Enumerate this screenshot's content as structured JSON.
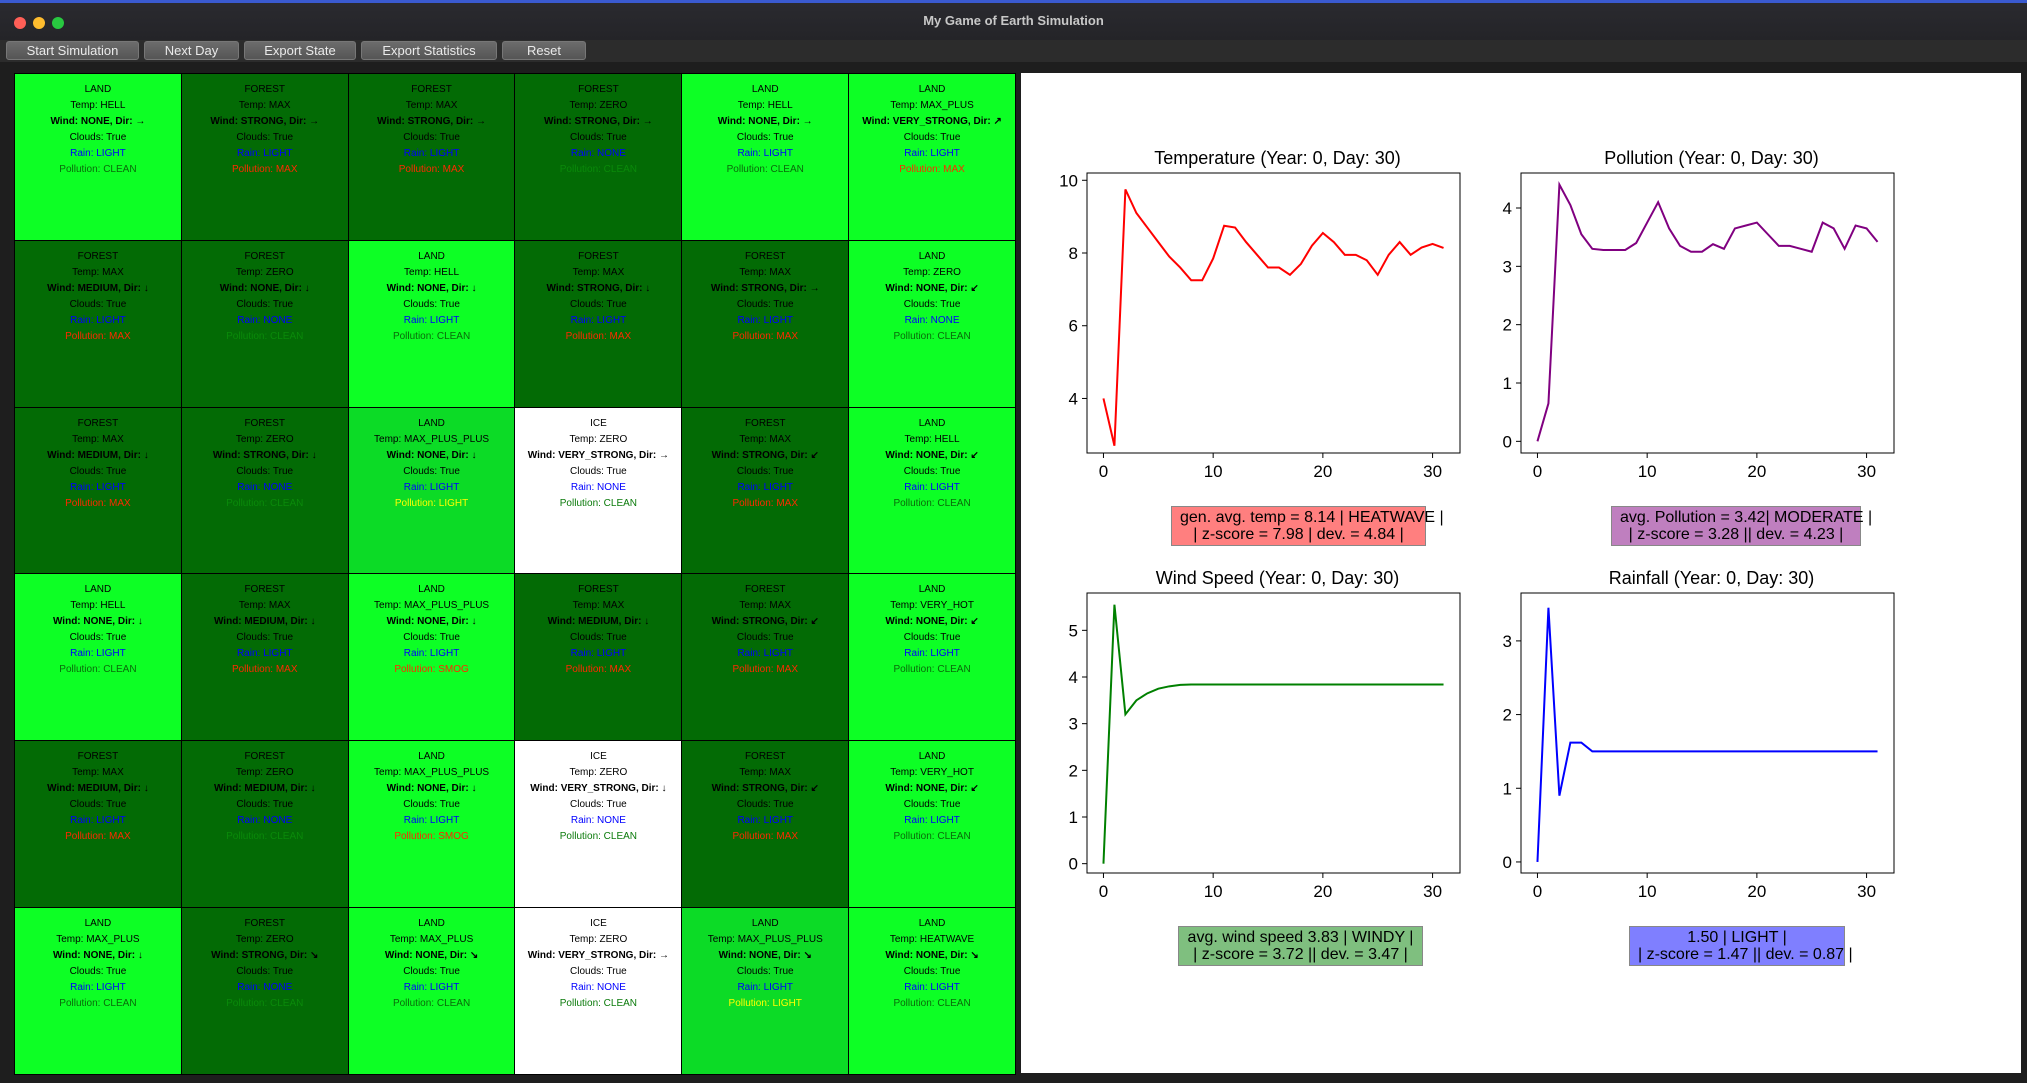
{
  "window": {
    "title": "My Game of Earth Simulation"
  },
  "toolbar": {
    "start": "Start Simulation",
    "next": "Next Day",
    "export_state": "Export State",
    "export_stats": "Export Statistics",
    "reset": "Reset"
  },
  "grid": {
    "colors": {
      "land": "#0dff25",
      "forest": "#036b05",
      "ice": "#ffffff",
      "light_land": "#0cdb26"
    },
    "cells": [
      {
        "type": "LAND",
        "bg": "land",
        "temp": "Temp: HELL",
        "wind": "Wind: NONE, Dir: →",
        "clouds": "Clouds: True",
        "rain": "Rain: LIGHT",
        "pollution": "Pollution: CLEAN",
        "pc": "#0a6a0a"
      },
      {
        "type": "FOREST",
        "bg": "forest",
        "temp": "Temp: MAX",
        "wind": "Wind: STRONG, Dir: →",
        "clouds": "Clouds: True",
        "rain": "Rain: LIGHT",
        "pollution": "Pollution: MAX",
        "pc": "#ff2a00"
      },
      {
        "type": "FOREST",
        "bg": "forest",
        "temp": "Temp: MAX",
        "wind": "Wind: STRONG, Dir: →",
        "clouds": "Clouds: True",
        "rain": "Rain: LIGHT",
        "pollution": "Pollution: MAX",
        "pc": "#ff2a00"
      },
      {
        "type": "FOREST",
        "bg": "forest",
        "temp": "Temp: ZERO",
        "wind": "Wind: STRONG, Dir: →",
        "clouds": "Clouds: True",
        "rain": "Rain: NONE",
        "pollution": "Pollution: CLEAN",
        "pc": "#0a8a0a"
      },
      {
        "type": "LAND",
        "bg": "land",
        "temp": "Temp: HELL",
        "wind": "Wind: NONE, Dir: →",
        "clouds": "Clouds: True",
        "rain": "Rain: LIGHT",
        "pollution": "Pollution: CLEAN",
        "pc": "#0a6a0a"
      },
      {
        "type": "LAND",
        "bg": "land",
        "temp": "Temp: MAX_PLUS",
        "wind": "Wind: VERY_STRONG, Dir: ↗",
        "clouds": "Clouds: True",
        "rain": "Rain: LIGHT",
        "pollution": "Pollution: MAX",
        "pc": "#ff2a00"
      },
      {
        "type": "FOREST",
        "bg": "forest",
        "temp": "Temp: MAX",
        "wind": "Wind: MEDIUM, Dir: ↓",
        "clouds": "Clouds: True",
        "rain": "Rain: LIGHT",
        "pollution": "Pollution: MAX",
        "pc": "#ff2a00"
      },
      {
        "type": "FOREST",
        "bg": "forest",
        "temp": "Temp: ZERO",
        "wind": "Wind: NONE, Dir: ↓",
        "clouds": "Clouds: True",
        "rain": "Rain: NONE",
        "pollution": "Pollution: CLEAN",
        "pc": "#0a8a0a"
      },
      {
        "type": "LAND",
        "bg": "land",
        "temp": "Temp: HELL",
        "wind": "Wind: NONE, Dir: ↓",
        "clouds": "Clouds: True",
        "rain": "Rain: LIGHT",
        "pollution": "Pollution: CLEAN",
        "pc": "#0a6a0a"
      },
      {
        "type": "FOREST",
        "bg": "forest",
        "temp": "Temp: MAX",
        "wind": "Wind: STRONG, Dir: ↓",
        "clouds": "Clouds: True",
        "rain": "Rain: LIGHT",
        "pollution": "Pollution: MAX",
        "pc": "#ff2a00"
      },
      {
        "type": "FOREST",
        "bg": "forest",
        "temp": "Temp: MAX",
        "wind": "Wind: STRONG, Dir: →",
        "clouds": "Clouds: True",
        "rain": "Rain: LIGHT",
        "pollution": "Pollution: MAX",
        "pc": "#ff2a00"
      },
      {
        "type": "LAND",
        "bg": "land",
        "temp": "Temp: ZERO",
        "wind": "Wind: NONE, Dir: ↙",
        "clouds": "Clouds: True",
        "rain": "Rain: NONE",
        "pollution": "Pollution: CLEAN",
        "pc": "#0a6a0a"
      },
      {
        "type": "FOREST",
        "bg": "forest",
        "temp": "Temp: MAX",
        "wind": "Wind: MEDIUM, Dir: ↓",
        "clouds": "Clouds: True",
        "rain": "Rain: LIGHT",
        "pollution": "Pollution: MAX",
        "pc": "#ff2a00"
      },
      {
        "type": "FOREST",
        "bg": "forest",
        "temp": "Temp: ZERO",
        "wind": "Wind: STRONG, Dir: ↓",
        "clouds": "Clouds: True",
        "rain": "Rain: NONE",
        "pollution": "Pollution: CLEAN",
        "pc": "#0a8a0a"
      },
      {
        "type": "LAND",
        "bg": "light_land",
        "temp": "Temp: MAX_PLUS_PLUS",
        "wind": "Wind: NONE, Dir: ↓",
        "clouds": "Clouds: True",
        "rain": "Rain: LIGHT",
        "pollution": "Pollution: LIGHT",
        "pc": "#ffff00"
      },
      {
        "type": "ICE",
        "bg": "ice",
        "temp": "Temp: ZERO",
        "wind": "Wind: VERY_STRONG, Dir: →",
        "clouds": "Clouds: True",
        "rain": "Rain: NONE",
        "pollution": "Pollution: CLEAN",
        "pc": "#0a7a0a"
      },
      {
        "type": "FOREST",
        "bg": "forest",
        "temp": "Temp: MAX",
        "wind": "Wind: STRONG, Dir: ↙",
        "clouds": "Clouds: True",
        "rain": "Rain: LIGHT",
        "pollution": "Pollution: MAX",
        "pc": "#ff2a00"
      },
      {
        "type": "LAND",
        "bg": "land",
        "temp": "Temp: HELL",
        "wind": "Wind: NONE, Dir: ↙",
        "clouds": "Clouds: True",
        "rain": "Rain: LIGHT",
        "pollution": "Pollution: CLEAN",
        "pc": "#0a6a0a"
      },
      {
        "type": "LAND",
        "bg": "land",
        "temp": "Temp: HELL",
        "wind": "Wind: NONE, Dir: ↓",
        "clouds": "Clouds: True",
        "rain": "Rain: LIGHT",
        "pollution": "Pollution: CLEAN",
        "pc": "#0a6a0a"
      },
      {
        "type": "FOREST",
        "bg": "forest",
        "temp": "Temp: MAX",
        "wind": "Wind: MEDIUM, Dir: ↓",
        "clouds": "Clouds: True",
        "rain": "Rain: LIGHT",
        "pollution": "Pollution: MAX",
        "pc": "#ff2a00"
      },
      {
        "type": "LAND",
        "bg": "land",
        "temp": "Temp: MAX_PLUS_PLUS",
        "wind": "Wind: NONE, Dir: ↓",
        "clouds": "Clouds: True",
        "rain": "Rain: LIGHT",
        "pollution": "Pollution: SMOG",
        "pc": "#ff2a00"
      },
      {
        "type": "FOREST",
        "bg": "forest",
        "temp": "Temp: MAX",
        "wind": "Wind: MEDIUM, Dir: ↓",
        "clouds": "Clouds: True",
        "rain": "Rain: LIGHT",
        "pollution": "Pollution: MAX",
        "pc": "#ff2a00"
      },
      {
        "type": "FOREST",
        "bg": "forest",
        "temp": "Temp: MAX",
        "wind": "Wind: STRONG, Dir: ↙",
        "clouds": "Clouds: True",
        "rain": "Rain: LIGHT",
        "pollution": "Pollution: MAX",
        "pc": "#ff2a00"
      },
      {
        "type": "LAND",
        "bg": "land",
        "temp": "Temp: VERY_HOT",
        "wind": "Wind: NONE, Dir: ↙",
        "clouds": "Clouds: True",
        "rain": "Rain: LIGHT",
        "pollution": "Pollution: CLEAN",
        "pc": "#0a6a0a"
      },
      {
        "type": "FOREST",
        "bg": "forest",
        "temp": "Temp: MAX",
        "wind": "Wind: MEDIUM, Dir: ↓",
        "clouds": "Clouds: True",
        "rain": "Rain: LIGHT",
        "pollution": "Pollution: MAX",
        "pc": "#ff2a00"
      },
      {
        "type": "FOREST",
        "bg": "forest",
        "temp": "Temp: ZERO",
        "wind": "Wind: MEDIUM, Dir: ↓",
        "clouds": "Clouds: True",
        "rain": "Rain: NONE",
        "pollution": "Pollution: CLEAN",
        "pc": "#0a8a0a"
      },
      {
        "type": "LAND",
        "bg": "land",
        "temp": "Temp: MAX_PLUS_PLUS",
        "wind": "Wind: NONE, Dir: ↓",
        "clouds": "Clouds: True",
        "rain": "Rain: LIGHT",
        "pollution": "Pollution: SMOG",
        "pc": "#ff2a00"
      },
      {
        "type": "ICE",
        "bg": "ice",
        "temp": "Temp: ZERO",
        "wind": "Wind: VERY_STRONG, Dir: ↓",
        "clouds": "Clouds: True",
        "rain": "Rain: NONE",
        "pollution": "Pollution: CLEAN",
        "pc": "#0a7a0a"
      },
      {
        "type": "FOREST",
        "bg": "forest",
        "temp": "Temp: MAX",
        "wind": "Wind: STRONG, Dir: ↙",
        "clouds": "Clouds: True",
        "rain": "Rain: LIGHT",
        "pollution": "Pollution: MAX",
        "pc": "#ff2a00"
      },
      {
        "type": "LAND",
        "bg": "land",
        "temp": "Temp: VERY_HOT",
        "wind": "Wind: NONE, Dir: ↙",
        "clouds": "Clouds: True",
        "rain": "Rain: LIGHT",
        "pollution": "Pollution: CLEAN",
        "pc": "#0a6a0a"
      },
      {
        "type": "LAND",
        "bg": "land",
        "temp": "Temp: MAX_PLUS",
        "wind": "Wind: NONE, Dir: ↓",
        "clouds": "Clouds: True",
        "rain": "Rain: LIGHT",
        "pollution": "Pollution: CLEAN",
        "pc": "#0a6a0a"
      },
      {
        "type": "FOREST",
        "bg": "forest",
        "temp": "Temp: ZERO",
        "wind": "Wind: STRONG, Dir: ↘",
        "clouds": "Clouds: True",
        "rain": "Rain: NONE",
        "pollution": "Pollution: CLEAN",
        "pc": "#0a8a0a"
      },
      {
        "type": "LAND",
        "bg": "land",
        "temp": "Temp: MAX_PLUS",
        "wind": "Wind: NONE, Dir: ↘",
        "clouds": "Clouds: True",
        "rain": "Rain: LIGHT",
        "pollution": "Pollution: CLEAN",
        "pc": "#0a6a0a"
      },
      {
        "type": "ICE",
        "bg": "ice",
        "temp": "Temp: ZERO",
        "wind": "Wind: VERY_STRONG, Dir: →",
        "clouds": "Clouds: True",
        "rain": "Rain: NONE",
        "pollution": "Pollution: CLEAN",
        "pc": "#0a7a0a"
      },
      {
        "type": "LAND",
        "bg": "light_land",
        "temp": "Temp: MAX_PLUS_PLUS",
        "wind": "Wind: NONE, Dir: ↘",
        "clouds": "Clouds: True",
        "rain": "Rain: LIGHT",
        "pollution": "Pollution: LIGHT",
        "pc": "#ffff00"
      },
      {
        "type": "LAND",
        "bg": "land",
        "temp": "Temp: HEATWAVE",
        "wind": "Wind: NONE, Dir: ↘",
        "clouds": "Clouds: True",
        "rain": "Rain: LIGHT",
        "pollution": "Pollution: CLEAN",
        "pc": "#0a6a0a"
      }
    ]
  },
  "charts": [
    {
      "id": "temp",
      "title": "Temperature (Year: 0, Day: 30)",
      "color": "#ff0000",
      "ylim": [
        2.5,
        10.2
      ],
      "yticks": [
        4,
        6,
        8,
        10
      ],
      "xticks": [
        0,
        10,
        20,
        30
      ],
      "xlim": [
        -1.5,
        32.5
      ],
      "stats": {
        "line1": "gen. avg. temp = 8.14 | HEATWAVE |",
        "line2": "| z-score = 7.98 | dev. = 4.84 |",
        "bg": "#ff7f7f"
      }
    },
    {
      "id": "poll",
      "title": "Pollution (Year: 0, Day: 30)",
      "color": "#800080",
      "ylim": [
        -0.2,
        4.6
      ],
      "yticks": [
        0,
        1,
        2,
        3,
        4
      ],
      "xticks": [
        0,
        10,
        20,
        30
      ],
      "xlim": [
        -1.5,
        32.5
      ],
      "stats": {
        "line1": "avg. Pollution = 3.42| MODERATE |",
        "line2": "| z-score = 3.28 || dev. = 4.23 |",
        "bg": "#bf7fbf"
      }
    },
    {
      "id": "wind",
      "title": "Wind Speed (Year: 0, Day: 30)",
      "color": "#008000",
      "ylim": [
        -0.2,
        5.8
      ],
      "yticks": [
        0,
        1,
        2,
        3,
        4,
        5
      ],
      "xticks": [
        0,
        10,
        20,
        30
      ],
      "xlim": [
        -1.5,
        32.5
      ],
      "stats": {
        "line1": "avg. wind speed 3.83 | WINDY |",
        "line2": "| z-score = 3.72 || dev. = 3.47 |",
        "bg": "#7fbf7f"
      }
    },
    {
      "id": "rain",
      "title": "Rainfall (Year: 0, Day: 30)",
      "color": "#0000ff",
      "ylim": [
        -0.15,
        3.65
      ],
      "yticks": [
        0,
        1,
        2,
        3
      ],
      "xticks": [
        0,
        10,
        20,
        30
      ],
      "xlim": [
        -1.5,
        32.5
      ],
      "stats": {
        "line1": "1.50 | LIGHT |",
        "line2": "| z-score = 1.47 || dev. = 0.87 |",
        "bg": "#7f7fff"
      }
    }
  ],
  "chart_data": [
    {
      "type": "line",
      "title": "Temperature (Year: 0, Day: 30)",
      "x": [
        0,
        1,
        2,
        3,
        4,
        5,
        6,
        7,
        8,
        9,
        10,
        11,
        12,
        13,
        14,
        15,
        16,
        17,
        18,
        19,
        20,
        21,
        22,
        23,
        24,
        25,
        26,
        27,
        28,
        29,
        30,
        31
      ],
      "values": [
        4.0,
        2.7,
        9.75,
        9.1,
        8.7,
        8.3,
        7.9,
        7.6,
        7.25,
        7.25,
        7.85,
        8.75,
        8.7,
        8.3,
        7.95,
        7.6,
        7.6,
        7.4,
        7.7,
        8.2,
        8.55,
        8.3,
        7.95,
        7.95,
        7.8,
        7.4,
        7.95,
        8.3,
        7.95,
        8.15,
        8.25,
        8.14
      ],
      "ylim": [
        2.5,
        10.2
      ]
    },
    {
      "type": "line",
      "title": "Pollution (Year: 0, Day: 30)",
      "x": [
        0,
        1,
        2,
        3,
        4,
        5,
        6,
        7,
        8,
        9,
        10,
        11,
        12,
        13,
        14,
        15,
        16,
        17,
        18,
        19,
        20,
        21,
        22,
        23,
        24,
        25,
        26,
        27,
        28,
        29,
        30,
        31
      ],
      "values": [
        0.0,
        0.65,
        4.4,
        4.05,
        3.55,
        3.3,
        3.28,
        3.28,
        3.28,
        3.4,
        3.75,
        4.1,
        3.65,
        3.35,
        3.25,
        3.25,
        3.38,
        3.3,
        3.65,
        3.7,
        3.75,
        3.55,
        3.35,
        3.35,
        3.3,
        3.25,
        3.75,
        3.65,
        3.3,
        3.7,
        3.65,
        3.42
      ],
      "ylim": [
        -0.2,
        4.6
      ]
    },
    {
      "type": "line",
      "title": "Wind Speed (Year: 0, Day: 30)",
      "x": [
        0,
        1,
        2,
        3,
        4,
        5,
        6,
        7,
        8,
        9,
        10,
        11,
        12,
        13,
        14,
        15,
        16,
        17,
        18,
        19,
        20,
        21,
        22,
        23,
        24,
        25,
        26,
        27,
        28,
        29,
        30,
        31
      ],
      "values": [
        0.0,
        5.55,
        3.2,
        3.5,
        3.65,
        3.75,
        3.8,
        3.83,
        3.84,
        3.84,
        3.84,
        3.84,
        3.84,
        3.84,
        3.84,
        3.84,
        3.84,
        3.84,
        3.84,
        3.84,
        3.84,
        3.84,
        3.84,
        3.84,
        3.84,
        3.84,
        3.84,
        3.84,
        3.84,
        3.84,
        3.84,
        3.84
      ],
      "ylim": [
        -0.2,
        5.8
      ]
    },
    {
      "type": "line",
      "title": "Rainfall (Year: 0, Day: 30)",
      "x": [
        0,
        1,
        2,
        3,
        4,
        5,
        6,
        7,
        8,
        9,
        10,
        11,
        12,
        13,
        14,
        15,
        16,
        17,
        18,
        19,
        20,
        21,
        22,
        23,
        24,
        25,
        26,
        27,
        28,
        29,
        30,
        31
      ],
      "values": [
        0.0,
        3.45,
        0.9,
        1.62,
        1.62,
        1.5,
        1.5,
        1.5,
        1.5,
        1.5,
        1.5,
        1.5,
        1.5,
        1.5,
        1.5,
        1.5,
        1.5,
        1.5,
        1.5,
        1.5,
        1.5,
        1.5,
        1.5,
        1.5,
        1.5,
        1.5,
        1.5,
        1.5,
        1.5,
        1.5,
        1.5,
        1.5
      ],
      "ylim": [
        -0.15,
        3.65
      ]
    }
  ]
}
